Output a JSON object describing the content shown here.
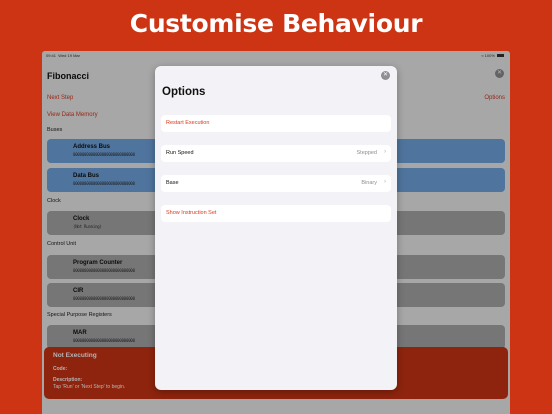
{
  "headline": "Customise Behaviour",
  "status_bar": {
    "time": "09:41",
    "date": "Wed 19 Mar",
    "battery": "100%"
  },
  "app": {
    "title": "Fibonacci",
    "next_step": "Next Step",
    "options": "Options",
    "view_memory": "View Data Memory"
  },
  "sections": {
    "buses": "Buses",
    "clock": "Clock",
    "control_unit": "Control Unit",
    "special": "Special Purpose Registers"
  },
  "cards": {
    "address_bus": {
      "name": "Address Bus",
      "value": "0000000000000000000000000000"
    },
    "data_bus": {
      "name": "Data Bus",
      "value": "0000000000000000000000000000"
    },
    "clock": {
      "name": "Clock",
      "value": "(Not Running)"
    },
    "program_counter": {
      "name": "Program Counter",
      "value": "0000000000000000000000000000"
    },
    "cir": {
      "name": "CIR",
      "value": "0000000000000000000000000000"
    },
    "mar": {
      "name": "MAR",
      "value": "0000000000000000000000000000"
    }
  },
  "banner": {
    "title": "Not Executing",
    "code_label": "Code:",
    "description_label": "Description:",
    "description": "Tap 'Run' or 'Next Step' to begin."
  },
  "modal": {
    "title": "Options",
    "restart": "Restart Execution",
    "run_speed_label": "Run Speed",
    "run_speed_value": "Stepped",
    "base_label": "Base",
    "base_value": "Binary",
    "show_instruction_set": "Show Instruction Set"
  },
  "colors": {
    "accent": "#d9391b",
    "background": "#cc3414",
    "blue_card": "#71a6e1",
    "gray_card": "#a9a9a9"
  }
}
